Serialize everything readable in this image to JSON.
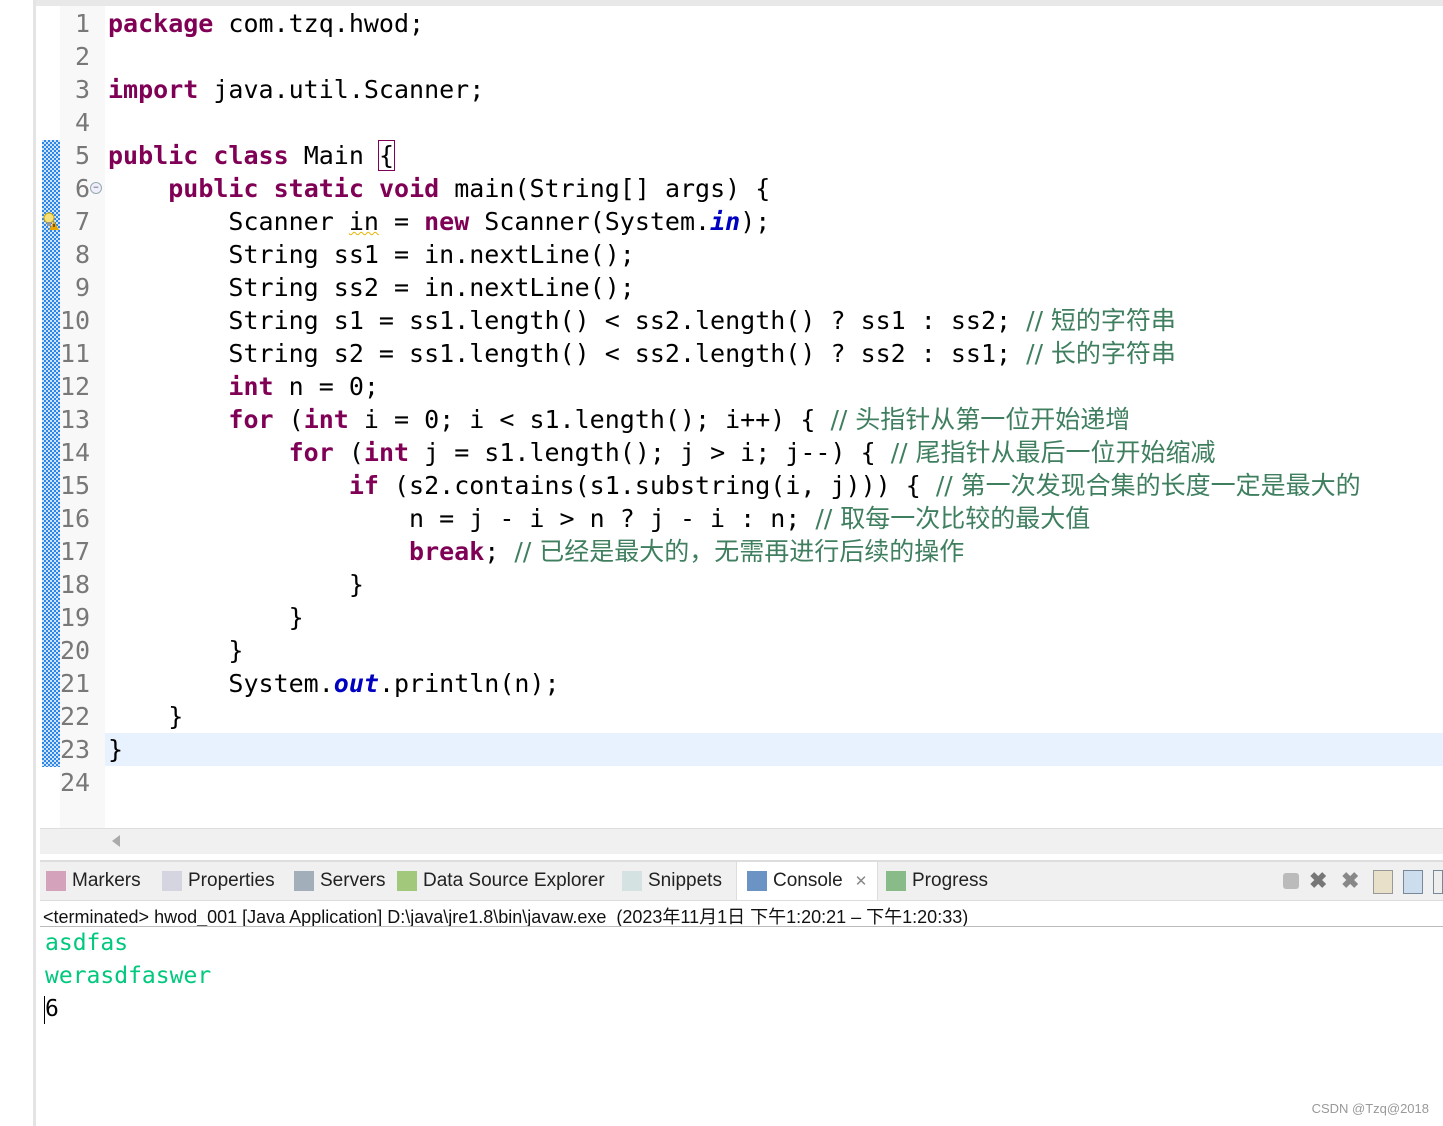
{
  "editor": {
    "lines": [
      [
        [
          "kw",
          "package"
        ],
        [
          "t",
          " com.tzq.hwod;"
        ]
      ],
      [],
      [
        [
          "kw",
          "import"
        ],
        [
          "t",
          " java.util.Scanner;"
        ]
      ],
      [],
      [
        [
          "kw",
          "public"
        ],
        [
          "t",
          " "
        ],
        [
          "kw",
          "class"
        ],
        [
          "t",
          " Main "
        ],
        [
          "box",
          "{"
        ]
      ],
      [
        [
          "t",
          "    "
        ],
        [
          "kw",
          "public"
        ],
        [
          "t",
          " "
        ],
        [
          "kw",
          "static"
        ],
        [
          "t",
          " "
        ],
        [
          "kw",
          "void"
        ],
        [
          "t",
          " main(String[] args) {"
        ]
      ],
      [
        [
          "t",
          "        Scanner "
        ],
        [
          "warn",
          "in"
        ],
        [
          "t",
          " = "
        ],
        [
          "kw",
          "new"
        ],
        [
          "t",
          " Scanner(System."
        ],
        [
          "fld",
          "in"
        ],
        [
          "t",
          ");"
        ]
      ],
      [
        [
          "t",
          "        String ss1 = in.nextLine();"
        ]
      ],
      [
        [
          "t",
          "        String ss2 = in.nextLine();"
        ]
      ],
      [
        [
          "t",
          "        String s1 = ss1.length() < ss2.length() ? ss1 : ss2; "
        ],
        [
          "cm",
          "// 短的字符串"
        ]
      ],
      [
        [
          "t",
          "        String s2 = ss1.length() < ss2.length() ? ss2 : ss1; "
        ],
        [
          "cm",
          "// 长的字符串"
        ]
      ],
      [
        [
          "t",
          "        "
        ],
        [
          "kw",
          "int"
        ],
        [
          "t",
          " n = 0;"
        ]
      ],
      [
        [
          "t",
          "        "
        ],
        [
          "kw",
          "for"
        ],
        [
          "t",
          " ("
        ],
        [
          "kw",
          "int"
        ],
        [
          "t",
          " i = 0; i < s1.length(); i++) { "
        ],
        [
          "cm",
          "// 头指针从第一位开始递增"
        ]
      ],
      [
        [
          "t",
          "            "
        ],
        [
          "kw",
          "for"
        ],
        [
          "t",
          " ("
        ],
        [
          "kw",
          "int"
        ],
        [
          "t",
          " j = s1.length(); j > i; j--) { "
        ],
        [
          "cm",
          "// 尾指针从最后一位开始缩减"
        ]
      ],
      [
        [
          "t",
          "                "
        ],
        [
          "kw",
          "if"
        ],
        [
          "t",
          " (s2.contains(s1.substring(i, j))) { "
        ],
        [
          "cm",
          "// 第一次发现合集的长度一定是最大的"
        ]
      ],
      [
        [
          "t",
          "                    n = j - i > n ? j - i : n; "
        ],
        [
          "cm",
          "// 取每一次比较的最大值"
        ]
      ],
      [
        [
          "t",
          "                    "
        ],
        [
          "kw",
          "break"
        ],
        [
          "t",
          "; "
        ],
        [
          "cm",
          "// 已经是最大的，无需再进行后续的操作"
        ]
      ],
      [
        [
          "t",
          "                }"
        ]
      ],
      [
        [
          "t",
          "            }"
        ]
      ],
      [
        [
          "t",
          "        }"
        ]
      ],
      [
        [
          "t",
          "        System."
        ],
        [
          "fld",
          "out"
        ],
        [
          "t",
          ".println(n);"
        ]
      ],
      [
        [
          "t",
          "    }"
        ]
      ],
      [
        [
          "t",
          "}"
        ]
      ],
      []
    ],
    "current_line": 23
  },
  "panel": {
    "tabs": [
      {
        "label": "Markers",
        "icon": "markers-icon"
      },
      {
        "label": "Properties",
        "icon": "properties-icon"
      },
      {
        "label": "Servers",
        "icon": "servers-icon"
      },
      {
        "label": "Data Source Explorer",
        "icon": "data-source-icon"
      },
      {
        "label": "Snippets",
        "icon": "snippets-icon"
      },
      {
        "label": "Console",
        "icon": "console-icon",
        "active": true
      },
      {
        "label": "Progress",
        "icon": "progress-icon"
      }
    ],
    "console_header": "<terminated> hwod_001 [Java Application] D:\\java\\jre1.8\\bin\\javaw.exe  (2023年11月1日 下午1:20:21 – 下午1:20:33)",
    "output": [
      {
        "text": "asdfas",
        "kind": "input"
      },
      {
        "text": "werasdfaswer",
        "kind": "input"
      },
      {
        "text": "6",
        "kind": "stdout"
      }
    ]
  },
  "colors": {
    "keyword": "#7f0055",
    "comment": "#3f7f5f",
    "field": "#0000c0",
    "console_input": "#00c87d",
    "current_line": "#e8f2fe"
  },
  "watermark": "CSDN @Tzq@2018"
}
